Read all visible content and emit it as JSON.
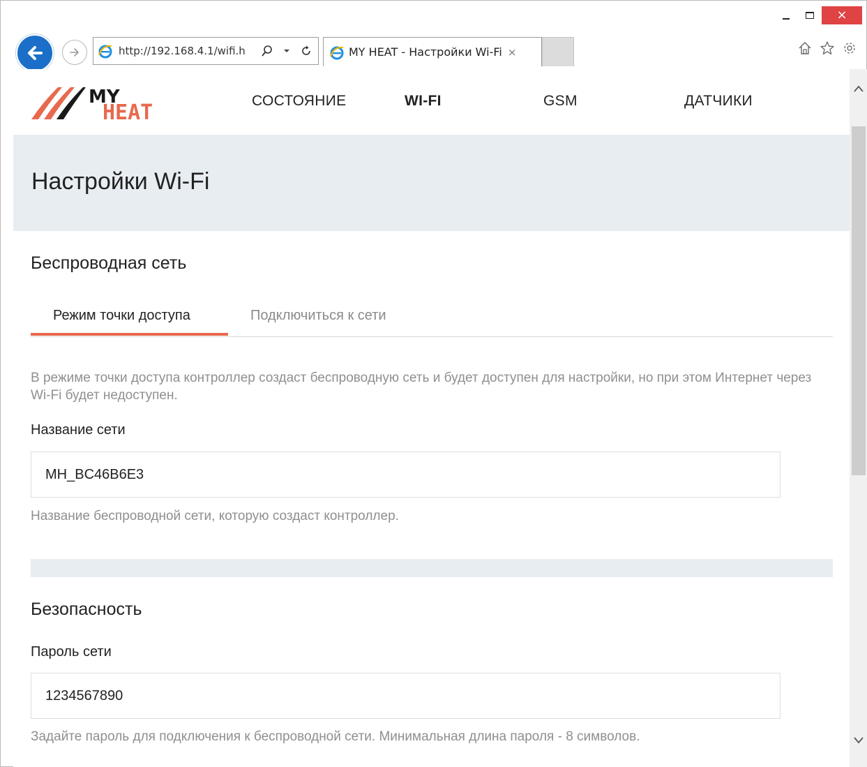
{
  "browser": {
    "url": "http://192.168.4.1/wifi.h",
    "tab_title": "MY HEAT - Настройки Wi-Fi",
    "tab_close": "×",
    "window_close": "×",
    "icons": [
      "back-arrow-icon",
      "forward-arrow-icon",
      "ie-logo-icon",
      "search-icon",
      "dropdown-icon",
      "refresh-icon",
      "home-icon",
      "favorites-star-icon",
      "settings-gear-icon"
    ]
  },
  "site": {
    "logo": {
      "line1": "MY",
      "line2": "HEAT"
    },
    "nav": [
      {
        "label": "СОСТОЯНИЕ",
        "active": false
      },
      {
        "label": "WI-FI",
        "active": true
      },
      {
        "label": "GSM",
        "active": false
      },
      {
        "label": "ДАТЧИКИ",
        "active": false
      }
    ]
  },
  "page": {
    "title": "Настройки Wi-Fi",
    "wireless": {
      "heading": "Беспроводная сеть",
      "tabs": [
        {
          "label": "Режим точки доступа",
          "active": true
        },
        {
          "label": "Подключиться к сети",
          "active": false
        }
      ],
      "description": "В режиме точки доступа контроллер создаст беспроводную сеть и будет доступен для настройки, но при этом Интернет через Wi-Fi будет недоступен.",
      "ssid_label": "Название сети",
      "ssid_value": "MH_BC46B6E3",
      "ssid_hint": "Название беспроводной сети, которую создаст контроллер."
    },
    "security": {
      "heading": "Безопасность",
      "password_label": "Пароль сети",
      "password_value": "1234567890",
      "password_hint": "Задайте пароль для подключения к беспроводной сети. Минимальная длина пароля - 8 символов."
    }
  },
  "colors": {
    "accent": "#e8694e",
    "band": "#e8edf2",
    "ie_blue": "#1b6fc8",
    "close_red": "#e04343"
  }
}
